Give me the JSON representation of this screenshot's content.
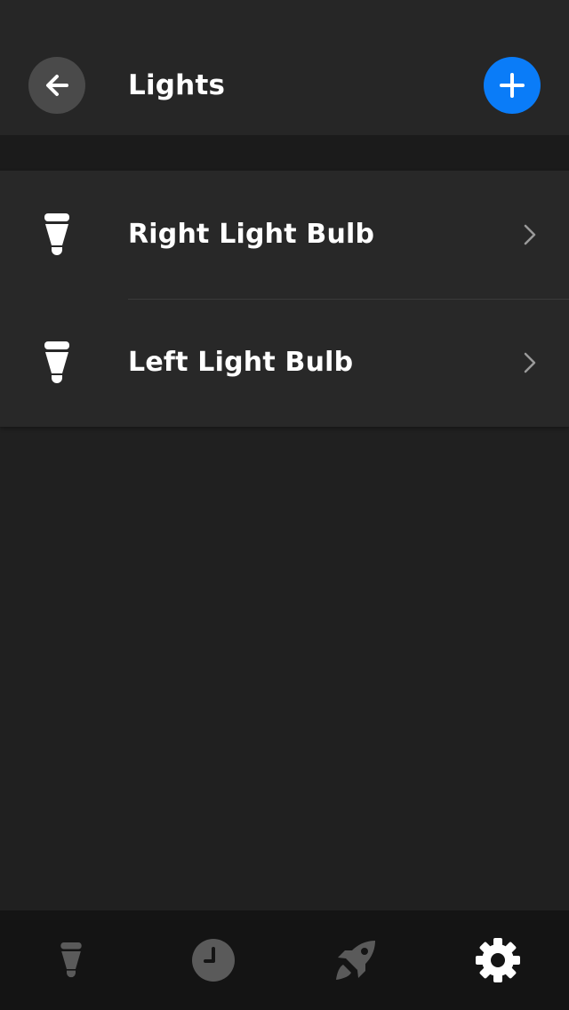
{
  "header": {
    "title": "Lights",
    "back_icon": "arrow-left-icon",
    "add_icon": "plus-icon"
  },
  "lights": [
    {
      "name": "Right Light Bulb",
      "icon": "light-bulb-icon"
    },
    {
      "name": "Left Light Bulb",
      "icon": "light-bulb-icon"
    }
  ],
  "tabbar": {
    "tabs": [
      {
        "icon": "light-bulb-icon",
        "active": false
      },
      {
        "icon": "clock-icon",
        "active": false
      },
      {
        "icon": "rocket-icon",
        "active": false
      },
      {
        "icon": "gear-icon",
        "active": true
      }
    ]
  },
  "colors": {
    "accent": "#0a7cf8",
    "background": "#202020",
    "header_bg": "#262626",
    "list_bg": "#282828",
    "tabbar_bg": "#141414",
    "inactive_icon": "#5a5a5a",
    "active_icon": "#ffffff"
  }
}
